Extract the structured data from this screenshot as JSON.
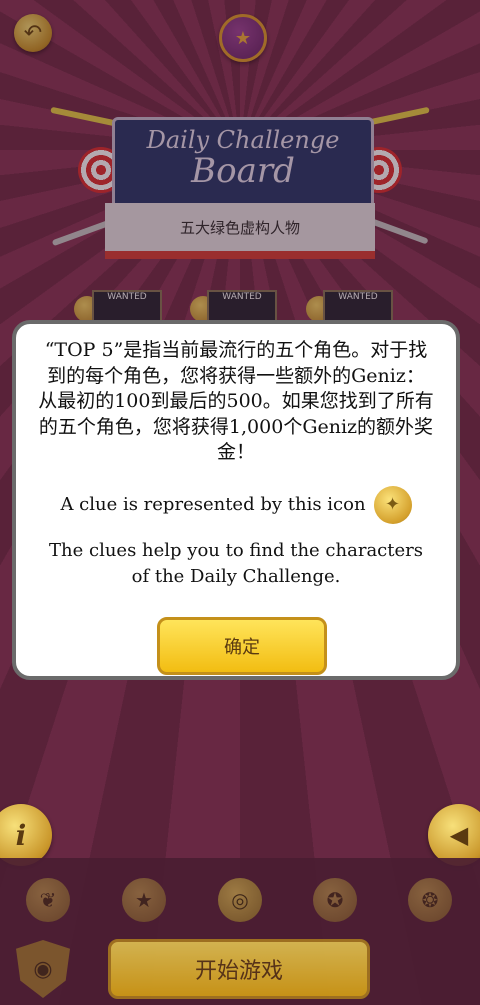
{
  "banner": {
    "line1": "Daily Challenge",
    "line2": "Board",
    "subtitle": "五大绿色虚构人物"
  },
  "wanted_cards": [
    "WANTED",
    "WANTED",
    "WANTED"
  ],
  "dialog": {
    "message": "“TOP 5”是指当前最流行的五个角色。对于找到的每个角色，您将获得一些额外的Geniz：从最初的100到最后的500。如果您找到了所有的五个角色，您将获得1,000个Geniz的额外奖金！",
    "clue_text": "A clue is represented by this icon",
    "help_text": "The clues help you to find the characters of the Daily Challenge.",
    "ok_label": "确定"
  },
  "side": {
    "info_glyph": "i"
  },
  "bottom": {
    "start_label": "开始游戏"
  },
  "icons": {
    "back": "back-arrow-icon",
    "profile": "profile-badge-icon",
    "info": "info-icon",
    "share": "megaphone-icon",
    "bulb": "lightbulb-icon"
  },
  "colors": {
    "background": "#8a3a5a",
    "accent": "#f2bd12"
  }
}
